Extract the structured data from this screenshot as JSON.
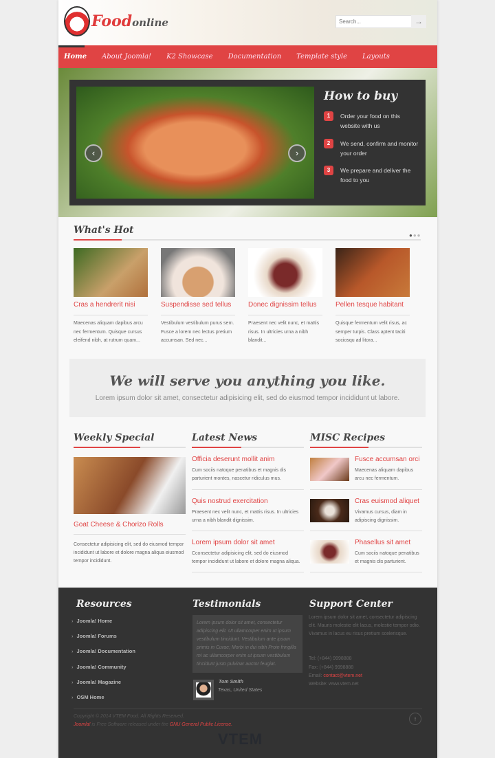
{
  "brand": {
    "name": "Food",
    "suffix": "online"
  },
  "search": {
    "placeholder": "Search..."
  },
  "nav": [
    "Home",
    "About Joomla!",
    "K2 Showcase",
    "Documentation",
    "Template style",
    "Layouts"
  ],
  "how_to_buy": {
    "title": "How to buy",
    "steps": [
      {
        "n": "1",
        "text": "Order your food on this website with us"
      },
      {
        "n": "2",
        "text": "We send, confirm and monitor your order"
      },
      {
        "n": "3",
        "text": "We prepare and deliver the food to you"
      }
    ]
  },
  "whats_hot": {
    "title": "What's Hot",
    "items": [
      {
        "title": "Cras a hendrerit nisi",
        "text": "Maecenas aliquam dapibus arcu nec fermentum. Quisque cursus eleifend nibh, at rutrum quam..."
      },
      {
        "title": "Suspendisse sed tellus",
        "text": "Vestibulum vestibulum purus sem. Fusce a lorem nec lectus pretium accumsan. Sed nec..."
      },
      {
        "title": "Donec dignissim tellus",
        "text": "Praesent nec velit nunc, et mattis risus. In ultricies urna a nibh blandit..."
      },
      {
        "title": "Pellen tesque habitant",
        "text": "Quisque fermentum velit risus, ac semper turpis. Class aptent taciti sociosqu ad litora..."
      }
    ]
  },
  "banner": {
    "heading": "We will serve you anything you like.",
    "sub": "Lorem ipsum dolor sit amet, consectetur adipisicing elit, sed do eiusmod tempor incididunt ut labore."
  },
  "weekly": {
    "title": "Weekly Special",
    "item_title": "Goat Cheese & Chorizo Rolls",
    "text": "Consectetur adipisicing elit, sed do eiusmod tempor incididunt ut labore et dolore magna aliqua eiusmod tempor incididunt."
  },
  "news": {
    "title": "Latest News",
    "items": [
      {
        "title": "Officia deserunt mollit anim",
        "text": "Cum sociis natoque penatibus et magnis dis parturient montes, nascetur ridiculus mus."
      },
      {
        "title": "Quis nostrud exercitation",
        "text": "Praesent nec velit nunc, et mattis risus. In ultricies urna a nibh blandit dignissim."
      },
      {
        "title": "Lorem ipsum dolor sit amet",
        "text": "Cconsectetur adipisicing elit, sed do eiusmod tempor incididunt ut labore et dolore magna aliqua."
      }
    ]
  },
  "recipes": {
    "title": "MISC Recipes",
    "items": [
      {
        "title": "Fusce accumsan orci",
        "text": "Maecenas aliquam dapibus arcu nec fermentum."
      },
      {
        "title": "Cras euismod aliquet",
        "text": "Vivamus cursus, diam in adipiscing dignissim."
      },
      {
        "title": "Phasellus sit amet",
        "text": "Cum sociis natoque penatibus et magnis dis parturient."
      }
    ]
  },
  "footer": {
    "resources": {
      "title": "Resources",
      "links": [
        "Joomla! Home",
        "Joomla! Forums",
        "Joomla! Documentation",
        "Joomla! Community",
        "Joomla! Magazine",
        "OSM Home"
      ]
    },
    "testimonials": {
      "title": "Testimonials",
      "quote": "Lorem ipsum dolor sit amet, consectetur adipiscing elit. Ut ullamcorper enim ut ipsum vestibulum tincidunt. Vestibulum ante ipsum primis in Curae; Morbi in dui nibh Proin fringilla mi ac ullamcorper enim ut ipsum vestibulum tincidunt justo pulvinar auctor feugiat.",
      "name": "Tom Smith",
      "location": "Texas, United States"
    },
    "support": {
      "title": "Support Center",
      "text": "Lorem ipsum dolor sit amet, consectetur adipiscing elit. Mauris molestie elit lacus, molestie tempor odio. Vivamus in lacus eu risus pretium scelerisque.",
      "tel": "Tel: (+844) 9998888",
      "fax": "Fax: (+844) 9998888",
      "email_label": "Email:",
      "email": "contact@vtem.net",
      "website": "Website: www.vtem.net"
    },
    "copyright": "Copyright © 2014 VTEM Food. All Rights Reserved.",
    "joomla": "Joomla!",
    "license_text": " is Free Software released under the ",
    "license": "GNU General Public License.",
    "vtem": "VTEM"
  },
  "colors": {
    "accent": "#e04444",
    "dark": "#333333"
  }
}
